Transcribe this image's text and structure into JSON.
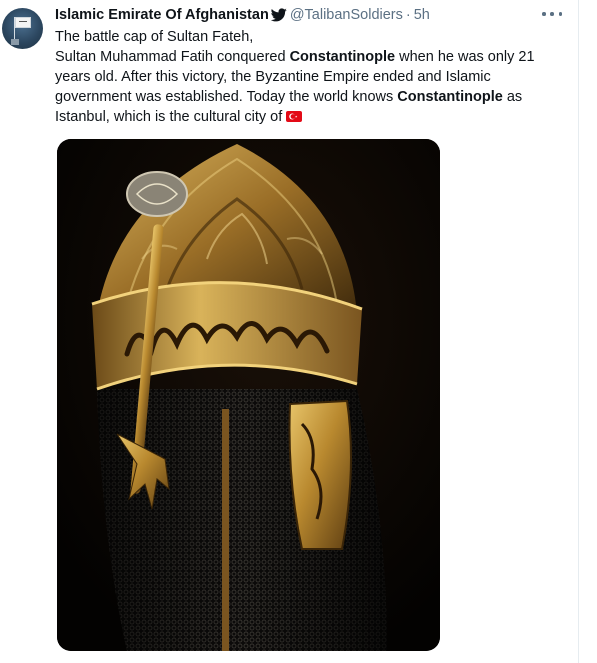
{
  "tweet": {
    "display_name": "Islamic Emirate Of Afghanistan",
    "handle": "@TalibanSoldiers",
    "separator": "·",
    "time": "5h",
    "lines": {
      "line1": "The battle cap of Sultan Fateh,",
      "line2_a": "Sultan Muhammad Fatih conquered ",
      "line2_b": "Constantinople",
      "line2_c": " when he was only 21 years old. After this victory, the Byzantine Empire ended and Islamic government was established. Today the world knows ",
      "line2_d": "Constantinople",
      "line2_e": " as Istanbul, which is the cultural city of"
    },
    "flag_emoji": "turkey-flag-emoji"
  },
  "icons": {
    "bird": "bird-icon",
    "more": "more-icon"
  },
  "colors": {
    "text": "#0f1419",
    "secondary": "#5b7083",
    "divider": "#e6ecf0",
    "flag_red": "#e30a17"
  },
  "media": {
    "subject": "gilded ottoman helmet photo"
  }
}
